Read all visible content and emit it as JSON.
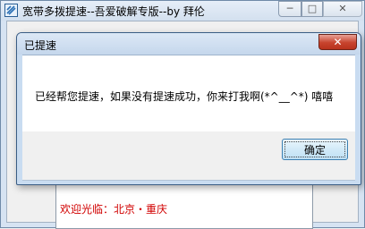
{
  "main_window": {
    "title": "宽带多拨提速--吾爱破解专版--by 拜伦",
    "controls": {
      "minimize": "─",
      "maximize": "□",
      "close": "✕"
    },
    "textbox_text": "欢迎光临：北京・重庆"
  },
  "dialog": {
    "title": "已提速",
    "close_label": "✕",
    "message": "已经帮您提速，如果没有提速成功，你来打我啊(*^__^*) 嘻嘻",
    "ok_label": "确定"
  }
}
